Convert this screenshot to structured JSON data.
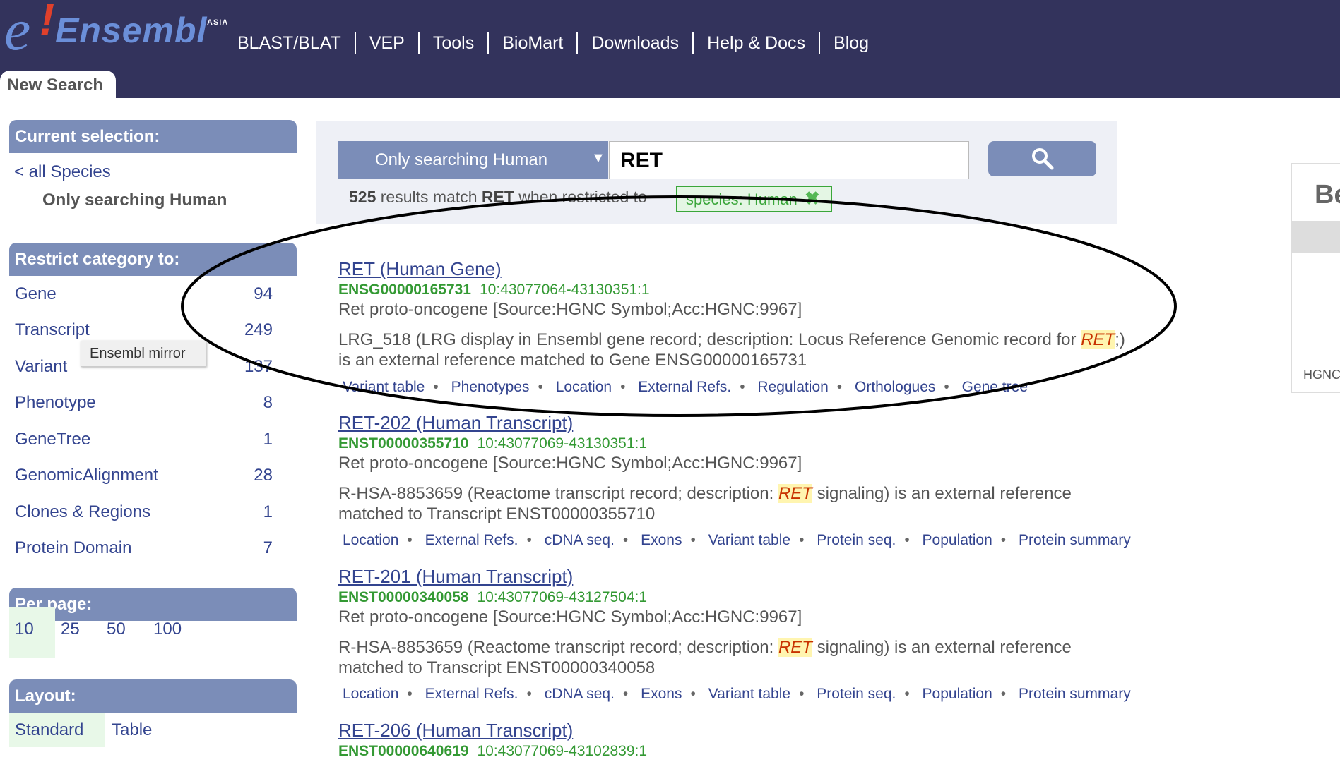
{
  "header": {
    "logo_letter": "e",
    "logo_bang": "!",
    "logo_word": "Ensembl",
    "logo_region": "ASIA",
    "nav": [
      "BLAST/BLAT",
      "VEP",
      "Tools",
      "BioMart",
      "Downloads",
      "Help & Docs",
      "Blog"
    ],
    "tab": "New Search"
  },
  "sidebar": {
    "current_heading": "Current selection:",
    "all_species_link": "< all Species",
    "only_human": "Only searching Human",
    "restrict_heading": "Restrict category to:",
    "categories": [
      {
        "label": "Gene",
        "count": "94"
      },
      {
        "label": "Transcript",
        "count": "249"
      },
      {
        "label": "Variant",
        "count": "137"
      },
      {
        "label": "Phenotype",
        "count": "8"
      },
      {
        "label": "GeneTree",
        "count": "1"
      },
      {
        "label": "GenomicAlignment",
        "count": "28"
      },
      {
        "label": "Clones & Regions",
        "count": "1"
      },
      {
        "label": "Protein Domain",
        "count": "7"
      }
    ],
    "tooltip": "Ensembl mirror",
    "perpage_heading": "Per page:",
    "perpage_options": [
      "10",
      "25",
      "50",
      "100"
    ],
    "layout_heading": "Layout:",
    "layout_options": [
      "Standard",
      "Table"
    ]
  },
  "search": {
    "species_select": "Only searching Human",
    "query": "RET",
    "summary_count": "525",
    "summary_mid": " results match ",
    "summary_term": "RET",
    "summary_tail": " when restricted to",
    "filter_label": "species: Human",
    "filter_remove": "✖",
    "button_icon": "search-icon"
  },
  "results": [
    {
      "title": "RET (Human Gene)",
      "id": "ENSG00000165731",
      "location": "10:43077064-43130351:1",
      "desc": "Ret proto-oncogene [Source:HGNC Symbol;Acc:HGNC:9967]",
      "xref_pre": "LRG_518 (LRG display in Ensembl gene record; description: Locus Reference Genomic record for ",
      "xref_hl": "RET",
      "xref_post": ";)",
      "xref_line2": "is an external reference matched to Gene ENSG00000165731",
      "links": [
        "Variant table",
        "Phenotypes",
        "Location",
        "External Refs.",
        "Regulation",
        "Orthologues",
        "Gene tree"
      ]
    },
    {
      "title": "RET-202 (Human Transcript)",
      "id": "ENST00000355710",
      "location": "10:43077069-43130351:1",
      "desc": "Ret proto-oncogene [Source:HGNC Symbol;Acc:HGNC:9967]",
      "xref_pre": "R-HSA-8853659 (Reactome transcript record; description: ",
      "xref_hl": "RET",
      "xref_post": " signaling) is an external reference",
      "xref_line2": "matched to Transcript ENST00000355710",
      "links": [
        "Location",
        "External Refs.",
        "cDNA seq.",
        "Exons",
        "Variant table",
        "Protein seq.",
        "Population",
        "Protein summary"
      ]
    },
    {
      "title": "RET-201 (Human Transcript)",
      "id": "ENST00000340058",
      "location": "10:43077069-43127504:1",
      "desc": "Ret proto-oncogene [Source:HGNC Symbol;Acc:HGNC:9967]",
      "xref_pre": "R-HSA-8853659 (Reactome transcript record; description: ",
      "xref_hl": "RET",
      "xref_post": " signaling) is an external reference",
      "xref_line2": "matched to Transcript ENST00000340058",
      "links": [
        "Location",
        "External Refs.",
        "cDNA seq.",
        "Exons",
        "Variant table",
        "Protein seq.",
        "Population",
        "Protein summary"
      ]
    },
    {
      "title": "RET-206 (Human Transcript)",
      "id": "ENST00000640619",
      "location": "10:43077069-43102839:1"
    }
  ],
  "right_panel": {
    "title": "Be",
    "label": "HGNC"
  },
  "colors": {
    "header_bg": "#33335c",
    "panel_heading": "#7b8db8",
    "link": "#33448f",
    "id_green": "#339933",
    "highlight": "#fff5b0"
  }
}
